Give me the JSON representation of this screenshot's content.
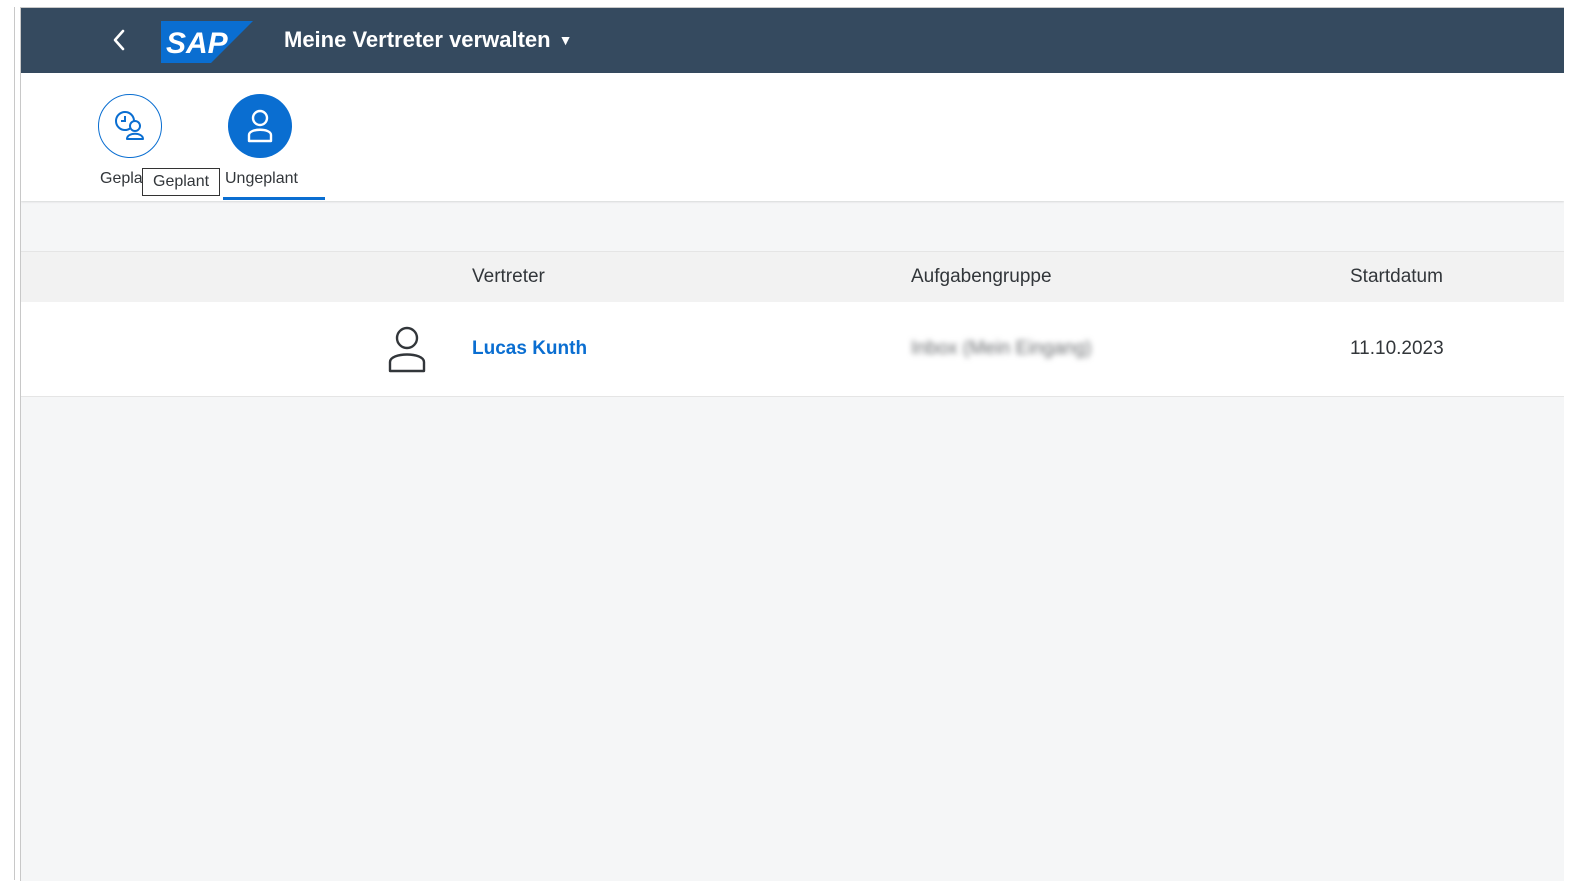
{
  "shell": {
    "logo_text": "SAP",
    "app_title": "Meine Vertreter verwalten",
    "brand_color": "#354a5f",
    "logo_color": "#0a6ed1"
  },
  "tabs": [
    {
      "label": "Geplant",
      "icon": "clock-person-icon",
      "selected": false
    },
    {
      "label": "Ungeplant",
      "icon": "person-icon",
      "selected": true
    }
  ],
  "tooltip": {
    "text": "Geplant"
  },
  "table": {
    "columns": [
      "Vertreter",
      "Aufgabengruppe",
      "Startdatum"
    ],
    "rows": [
      {
        "icon": "person-icon",
        "vertreter": "Lucas Kunth",
        "aufgabengruppe": "Inbox (Mein Eingang)",
        "startdatum": "11.10.2023"
      }
    ]
  },
  "colors": {
    "accent": "#0a6ed1",
    "text": "#32363a",
    "background": "#f5f6f7"
  }
}
